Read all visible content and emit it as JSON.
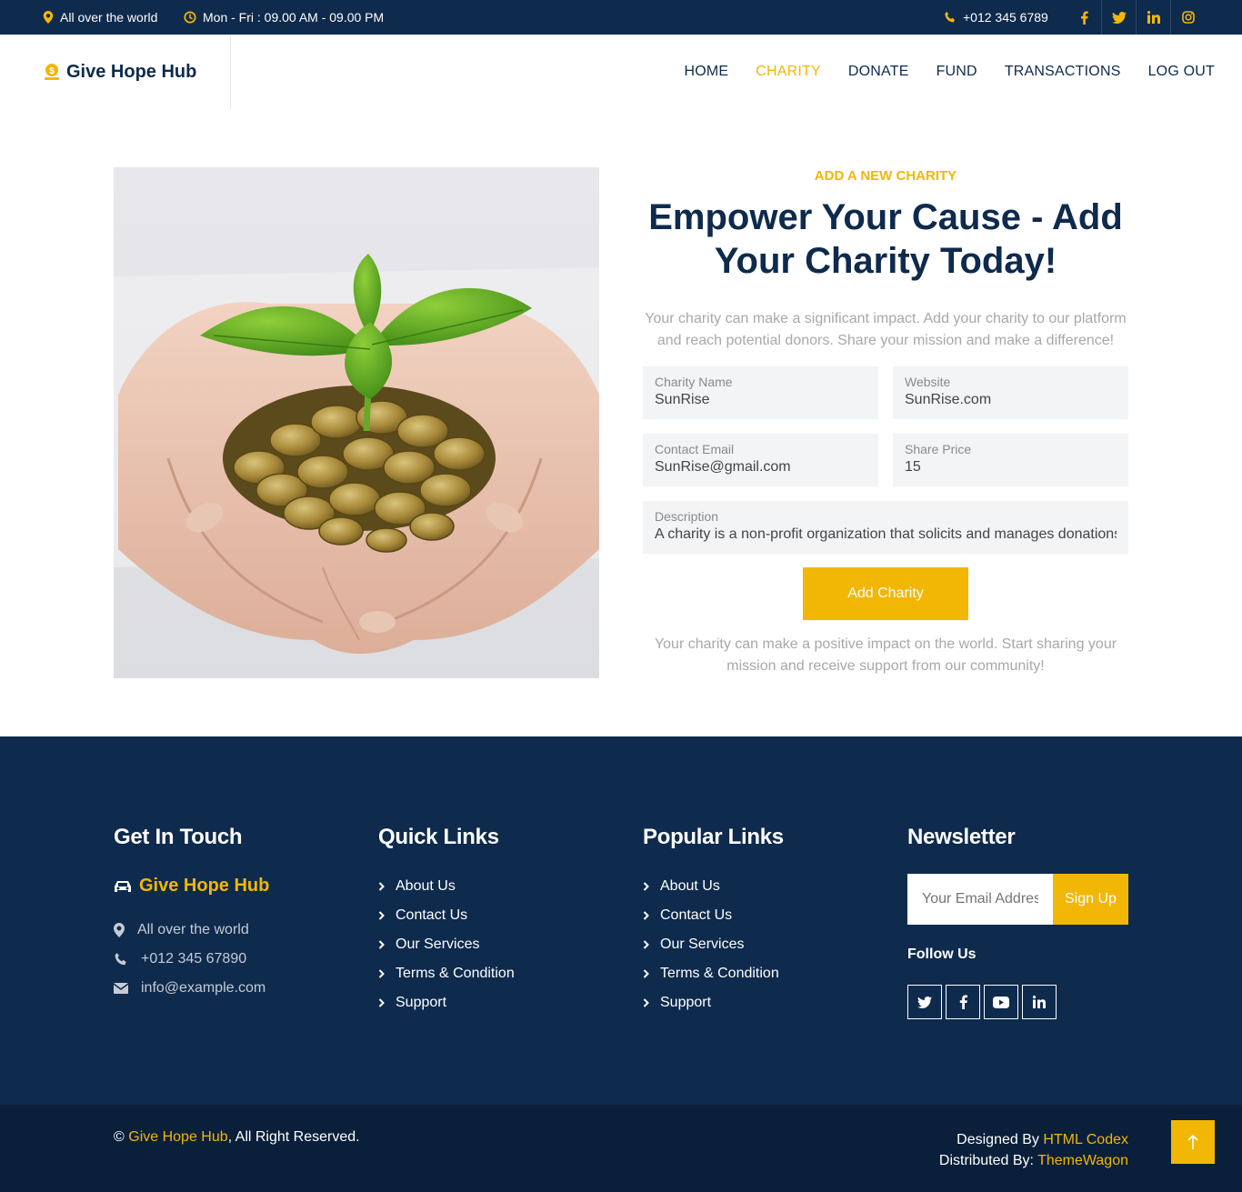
{
  "topbar": {
    "location": "All over the world",
    "hours": "Mon - Fri : 09.00 AM - 09.00 PM",
    "phone": "+012 345 6789",
    "social_icons": [
      "facebook-icon",
      "twitter-icon",
      "linkedin-icon",
      "instagram-icon"
    ]
  },
  "navbar": {
    "brand": "Give Hope Hub",
    "items": [
      {
        "label": "HOME",
        "active": false
      },
      {
        "label": "CHARITY",
        "active": true
      },
      {
        "label": "DONATE",
        "active": false
      },
      {
        "label": "FUND",
        "active": false
      },
      {
        "label": "TRANSACTIONS",
        "active": false
      },
      {
        "label": "LOG OUT",
        "active": false
      }
    ]
  },
  "form": {
    "eyebrow": "ADD A NEW CHARITY",
    "title": "Empower Your Cause - Add Your Charity Today!",
    "lead": "Your charity can make a significant impact. Add your charity to our platform and reach potential donors. Share your mission and make a difference!",
    "fields": {
      "charity_name": {
        "label": "Charity Name",
        "value": "SunRise"
      },
      "website": {
        "label": "Website",
        "value": "SunRise.com"
      },
      "contact_email": {
        "label": "Contact Email",
        "value": "SunRise@gmail.com"
      },
      "share_price": {
        "label": "Share Price",
        "value": "15"
      },
      "description": {
        "label": "Description",
        "value": "A charity is a non-profit organization that solicits and manages donations"
      }
    },
    "submit_label": "Add Charity",
    "note": "Your charity can make a positive impact on the world. Start sharing your mission and receive support from our community!"
  },
  "footer": {
    "get_in_touch": {
      "heading": "Get In Touch",
      "brand": "Give Hope Hub",
      "address": "All over the world",
      "phone": "+012 345 67890",
      "email": "info@example.com"
    },
    "quick_links": {
      "heading": "Quick Links",
      "items": [
        "About Us",
        "Contact Us",
        "Our Services",
        "Terms & Condition",
        "Support"
      ]
    },
    "popular_links": {
      "heading": "Popular Links",
      "items": [
        "About Us",
        "Contact Us",
        "Our Services",
        "Terms & Condition",
        "Support"
      ]
    },
    "newsletter": {
      "heading": "Newsletter",
      "placeholder": "Your Email Address",
      "button": "Sign Up",
      "follow_label": "Follow Us",
      "social_icons": [
        "twitter-icon",
        "facebook-icon",
        "youtube-icon",
        "linkedin-icon"
      ]
    }
  },
  "bottom": {
    "copy_symbol": "©",
    "copy_brand": "Give Hope Hub",
    "copy_rest": ", All Right Reserved.",
    "designed_label": "Designed By ",
    "designed_by": "HTML Codex",
    "distributed_label": "Distributed By: ",
    "distributed_by": "ThemeWagon"
  },
  "colors": {
    "navy": "#0e2a4d",
    "accent": "#f2b705",
    "field_bg": "#f2f4f6"
  }
}
